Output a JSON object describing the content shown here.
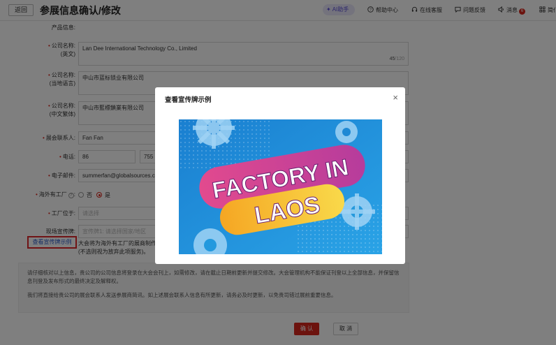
{
  "header": {
    "back_label": "返回",
    "title": "参展信息确认/修改",
    "ai_label": "AI助手",
    "help_label": "帮助中心",
    "service_label": "在线客服",
    "feedback_label": "问题反馈",
    "messages_label": "消息",
    "messages_count": "6",
    "cut_label": "简仆"
  },
  "form": {
    "product_info_label": "产品信息:",
    "company_en_label": "公司名称:",
    "company_en_sub": "(英文)",
    "company_en_value": "Lan Dee International Technology Co., Limited",
    "company_en_count": "45",
    "company_en_total": "/120",
    "company_local_label": "公司名称:",
    "company_local_sub": "(当地语言)",
    "company_local_value": "中山市蓝标锁业有限公司",
    "company_tc_label": "公司名称:",
    "company_tc_sub": "(中文繁体)",
    "company_tc_value": "中山市藍標鎖業有限公司",
    "contact_label": "展会联系人:",
    "contact_value": "Fan Fan",
    "phone_label": "电话:",
    "phone_code": "86",
    "phone_area": "755",
    "email_label": "电子邮件:",
    "email_value": "summerfan@globalsources.co",
    "overseas_label": "海外有工厂",
    "overseas_no": "否",
    "overseas_yes": "是",
    "factory_location_label": "工厂位于:",
    "factory_location_placeholder": "请选择",
    "signboard_label": "现场宣传牌:",
    "signboard_placeholder": "宣传牌1: 请选择国家/地区",
    "example_link": "查看宣传牌示例",
    "example_note_1": "大会将为海外有工厂的展商制作",
    "example_note_2": "(不选则视为放弃此项服务)。"
  },
  "notice": {
    "line1": "请仔细核对以上信息，贵公司的公司信息将登录在大会会刊上，如需修改，请在截止日期前更新并提交修改。大会管理机构不能保证刊登以上全部信息，并保留信息刊登及发布形式的最终决定及解释权。",
    "line2": "我们将直接给贵公司的展会联系人发送参展商简讯。如上述展会联系人信息有所更新，请务必及时更新，以免贵司错过展前重要信息。"
  },
  "buttons": {
    "confirm": "确 认",
    "cancel": "取 消"
  },
  "modal": {
    "title": "查看宣传牌示例",
    "close": "×",
    "banner_line1": "FACTORY IN",
    "banner_line2": "LAOS"
  },
  "colors": {
    "accent_red": "#d9261c",
    "link_blue": "#2a59c9",
    "banner_blue": "#1e8fd6",
    "banner_pink": "#d6468c",
    "banner_yellow": "#f7c631"
  }
}
